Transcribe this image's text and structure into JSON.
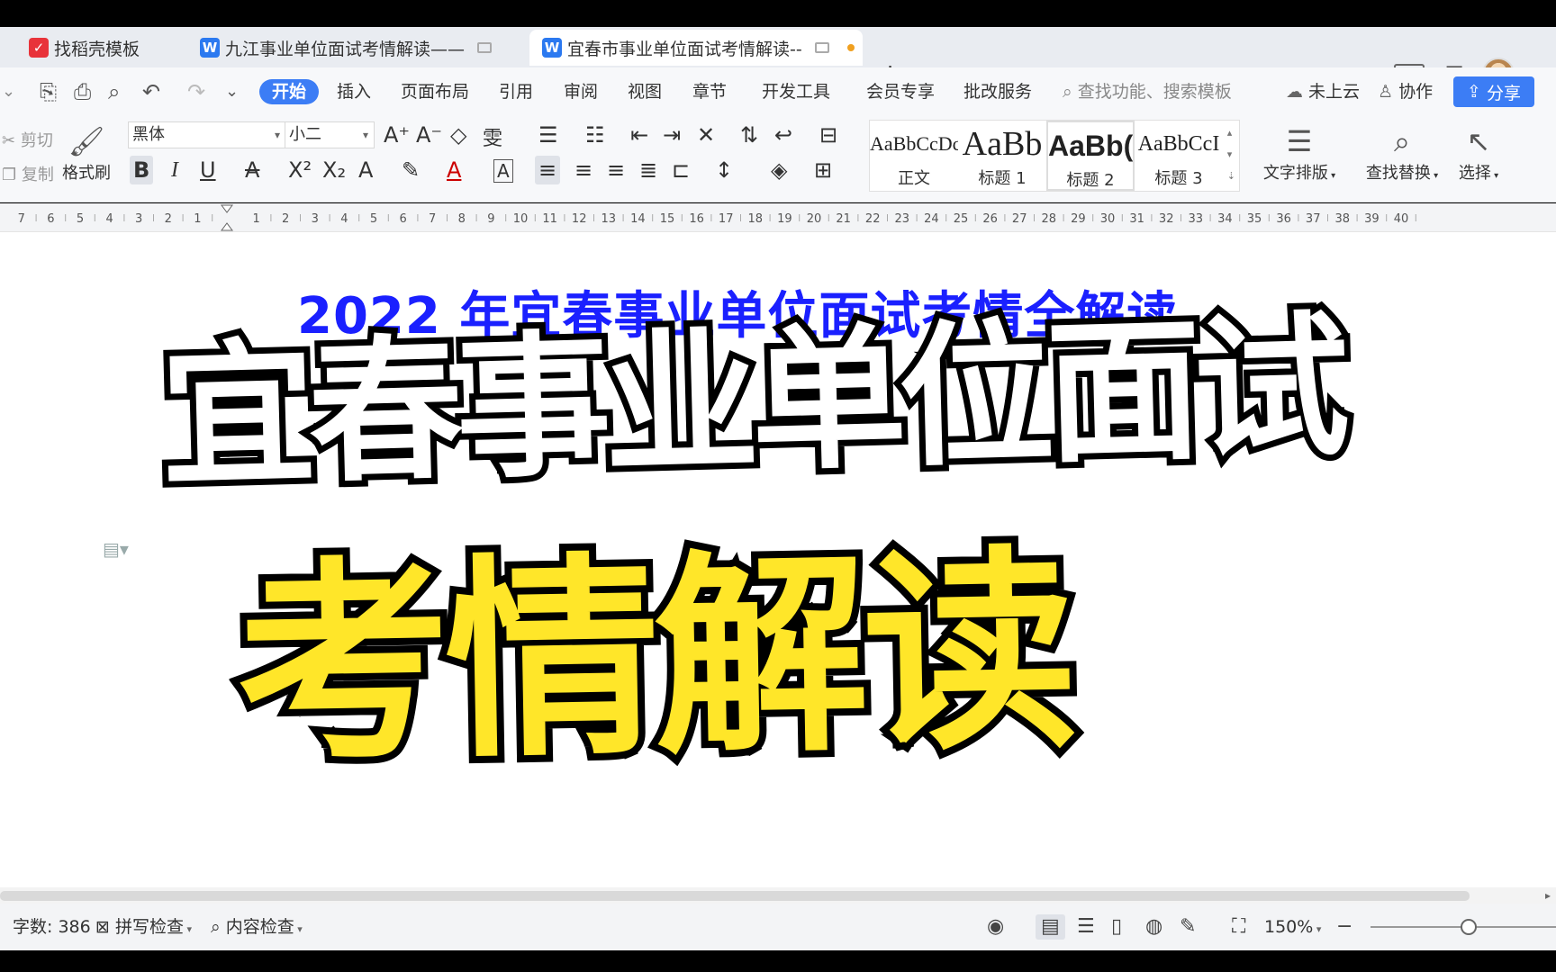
{
  "tabs": [
    {
      "label": "找稻壳模板",
      "icon": "docer-icon",
      "color": "#e8333a"
    },
    {
      "label": "九江事业单位面试考情解读——",
      "icon": "wps-writer-icon",
      "color": "#2b79f0"
    },
    {
      "label": "宜春市事业单位面试考情解读--",
      "icon": "wps-writer-icon",
      "color": "#2b79f0"
    }
  ],
  "window": {
    "tile_badge": "2"
  },
  "menu": {
    "items": [
      "开始",
      "插入",
      "页面布局",
      "引用",
      "审阅",
      "视图",
      "章节",
      "开发工具",
      "会员专享",
      "批改服务"
    ],
    "search_placeholder": "查找功能、搜索模板",
    "cloud": "未上云",
    "collab": "协作",
    "share": "分享"
  },
  "ribbon": {
    "cut": "剪切",
    "copy": "复制",
    "format_painter": "格式刷",
    "font_name": "黑体",
    "font_size": "小二",
    "styles": [
      {
        "sample": "AaBbCcDc",
        "label": "正文"
      },
      {
        "sample": "AaBb",
        "label": "标题 1"
      },
      {
        "sample": "AaBb(",
        "label": "标题 2"
      },
      {
        "sample": "AaBbCcI",
        "label": "标题 3"
      }
    ],
    "text_layout": "文字排版",
    "find_replace": "查找替换",
    "select": "选择"
  },
  "ruler": {
    "left_ticks": [
      "7",
      "6",
      "5",
      "4",
      "3",
      "2",
      "1"
    ],
    "right_ticks": [
      "1",
      "2",
      "3",
      "4",
      "5",
      "6",
      "7",
      "8",
      "9",
      "10",
      "11",
      "12",
      "13",
      "14",
      "15",
      "16",
      "17",
      "18",
      "19",
      "20",
      "21",
      "22",
      "23",
      "24",
      "25",
      "26",
      "27",
      "28",
      "29",
      "30",
      "31",
      "32",
      "33",
      "34",
      "35",
      "36",
      "37",
      "38",
      "39",
      "40"
    ]
  },
  "document": {
    "title": "2022 年宜春事业单位面试考情全解读",
    "overlay_line1": "宜春事业单位面试",
    "overlay_line2": "考情解读",
    "overlay_colors": {
      "line1_fill": "#ffffff",
      "line2_fill": "#ffe629",
      "stroke": "#000000"
    }
  },
  "status": {
    "word_count": "字数: 386",
    "spell_check": "拼写检查",
    "content_check": "内容检查",
    "zoom": "150%"
  },
  "colors": {
    "accent": "#3c7df5",
    "title_blue": "#1a20ff"
  }
}
